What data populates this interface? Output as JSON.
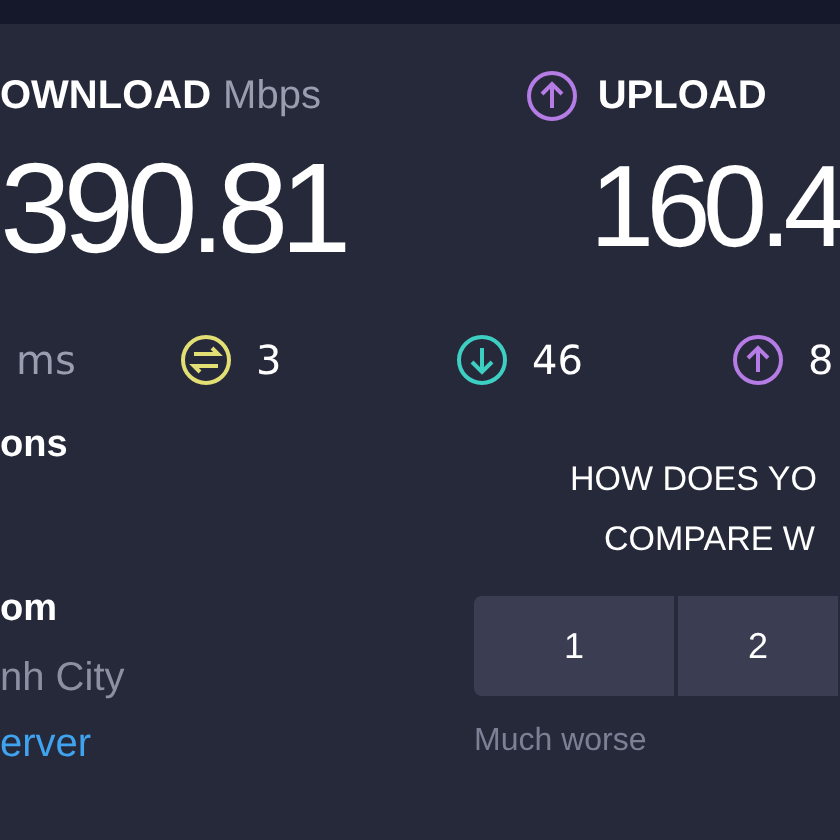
{
  "download": {
    "label": "OWNLOAD",
    "unit": "Mbps",
    "value": "390.81"
  },
  "upload": {
    "label": "UPLOAD",
    "value": "160.4"
  },
  "ping": {
    "unit": "ms",
    "items": [
      {
        "kind": "jitter",
        "value": "3"
      },
      {
        "kind": "download",
        "value": "46"
      },
      {
        "kind": "upload",
        "value": "8"
      }
    ]
  },
  "connections": {
    "title": "ons"
  },
  "server": {
    "name": "om",
    "location": "nh City",
    "link": "erver"
  },
  "compare": {
    "question_lines": [
      "HOW DOES YO",
      "COMPARE W"
    ],
    "options": [
      "1",
      "2"
    ],
    "min_label": "Much worse"
  }
}
